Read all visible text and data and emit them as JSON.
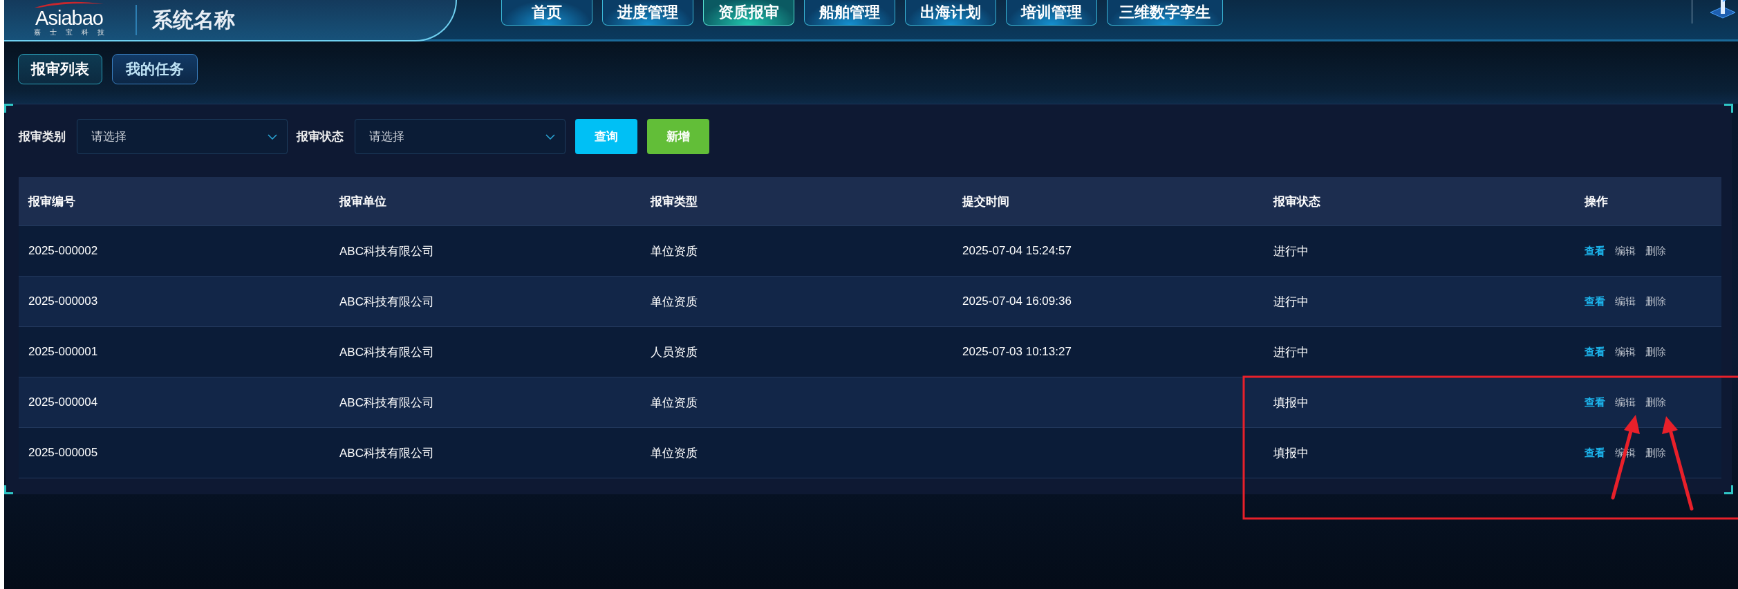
{
  "header": {
    "logo": {
      "brand": "Asiabao",
      "subtitle": "嘉士宝科技"
    },
    "title": "系统名称"
  },
  "nav": [
    {
      "label": "首页",
      "selected": false
    },
    {
      "label": "进度管理",
      "selected": false
    },
    {
      "label": "资质报审",
      "selected": true
    },
    {
      "label": "船舶管理",
      "selected": false
    },
    {
      "label": "出海计划",
      "selected": false
    },
    {
      "label": "培训管理",
      "selected": false
    },
    {
      "label": "三维数字孪生",
      "selected": false
    }
  ],
  "subtabs": [
    {
      "label": "报审列表",
      "selected": true
    },
    {
      "label": "我的任务",
      "selected": false
    }
  ],
  "filters": [
    {
      "label": "报审类别",
      "placeholder": "请选择"
    },
    {
      "label": "报审状态",
      "placeholder": "请选择"
    }
  ],
  "buttons": [
    {
      "label": "查询",
      "kind": "primary"
    },
    {
      "label": "新增",
      "kind": "success"
    }
  ],
  "table": {
    "columns": [
      "报审编号",
      "报审单位",
      "报审类型",
      "提交时间",
      "报审状态",
      "操作"
    ],
    "rows": [
      {
        "cells": [
          "2025-000002",
          "ABC科技有限公司",
          "单位资质",
          "2025-07-04 15:24:57",
          "进行中"
        ],
        "actions": [
          {
            "label": "查看",
            "kind": "view"
          },
          {
            "label": "编辑",
            "kind": "edit"
          },
          {
            "label": "删除",
            "kind": "delete"
          }
        ]
      },
      {
        "cells": [
          "2025-000003",
          "ABC科技有限公司",
          "单位资质",
          "2025-07-04 16:09:36",
          "进行中"
        ],
        "actions": [
          {
            "label": "查看",
            "kind": "view"
          },
          {
            "label": "编辑",
            "kind": "edit"
          },
          {
            "label": "删除",
            "kind": "delete"
          }
        ]
      },
      {
        "cells": [
          "2025-000001",
          "ABC科技有限公司",
          "人员资质",
          "2025-07-03 10:13:27",
          "进行中"
        ],
        "actions": [
          {
            "label": "查看",
            "kind": "view"
          },
          {
            "label": "编辑",
            "kind": "edit"
          },
          {
            "label": "删除",
            "kind": "delete"
          }
        ]
      },
      {
        "cells": [
          "2025-000004",
          "ABC科技有限公司",
          "单位资质",
          null,
          "填报中"
        ],
        "actions": [
          {
            "label": "查看",
            "kind": "view"
          },
          {
            "label": "编辑",
            "kind": "edit"
          },
          {
            "label": "删除",
            "kind": "delete"
          }
        ]
      },
      {
        "cells": [
          "2025-000005",
          "ABC科技有限公司",
          "单位资质",
          null,
          "填报中"
        ],
        "actions": [
          {
            "label": "查看",
            "kind": "view"
          },
          {
            "label": "编辑",
            "kind": "edit"
          },
          {
            "label": "删除",
            "kind": "delete"
          }
        ]
      }
    ]
  }
}
